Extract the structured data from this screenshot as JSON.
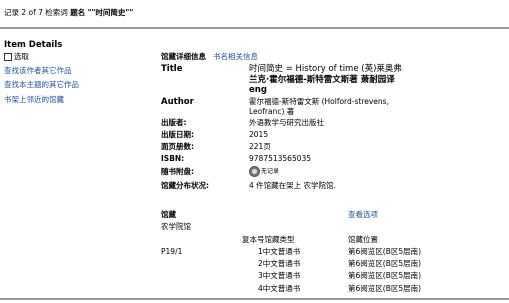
{
  "header": {
    "record_position": "记录 2 of 7 检索词",
    "query_label": "题名",
    "query_value": "\"\"时间简史\"\""
  },
  "sidebar": {
    "section_title": "Item Details",
    "select_label": "选取",
    "links": [
      "查找该作者其它作品",
      "查找本主题的其它作品",
      "书架上邻近的馆藏"
    ]
  },
  "details": {
    "heading": "馆藏详细信息",
    "heading_link": "书名相关信息",
    "fields": [
      {
        "label": "Title",
        "value_line1": "时间简史 = History of time (英)莱奥弗",
        "value_cont": [
          "兰克·霍尔福德-斯特雷文斯著 萧耐园译",
          "eng"
        ]
      },
      {
        "label": "Author",
        "value_line1": "霍尔福德-斯特雷文斯 (Holford-strevens,",
        "value_line2": "Leofranc) 著"
      },
      {
        "label": "出版者:",
        "value": "外语教学与研究出版社"
      },
      {
        "label": "出版日期:",
        "value": "2015"
      },
      {
        "label": "面页册数:",
        "value": "221页"
      },
      {
        "label": "ISBN:",
        "value": "9787513565035"
      },
      {
        "label": "随书附盘:",
        "value": "无记录"
      },
      {
        "label": "馆藏分布状况:",
        "value": "4 件馆藏在架上 农学院馆."
      }
    ]
  },
  "holdings": {
    "section_label": "馆藏",
    "view_options": "查看选项",
    "library": "农学院馆",
    "columns": [
      "复本号馆藏类型",
      "馆藏位置"
    ],
    "call_number": "P19/1",
    "rows": [
      {
        "copy": "1中文普通书",
        "location": "第6阅览区(B区5层南)"
      },
      {
        "copy": "2中文普通书",
        "location": "第6阅览区(B区5层南)"
      },
      {
        "copy": "3中文普通书",
        "location": "第6阅览区(B区5层南)"
      },
      {
        "copy": "4中文普通书",
        "location": "第6阅览区(B区5层南)"
      }
    ]
  }
}
